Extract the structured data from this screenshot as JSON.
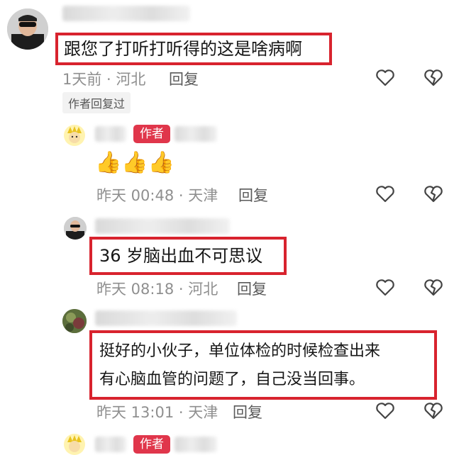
{
  "comments": [
    {
      "text": "跟您了打听打听得的这是啥病啊",
      "meta": "1天前 · 河北",
      "reply_label": "回复",
      "author_replied": "作者回复过"
    },
    {
      "badge": "作者",
      "emoji": "👍👍👍",
      "meta": "昨天 00:48 · 天津",
      "reply_label": "回复"
    },
    {
      "text": "36 岁脑出血不可思议",
      "meta": "昨天 08:18 · 河北",
      "reply_label": "回复"
    },
    {
      "line1": "挺好的小伙子，单位体检的时候检查出来",
      "line2": "有心脑血管的问题了，自己没当回事。",
      "meta": "昨天 13:01 · 天津",
      "reply_label": "回复"
    },
    {
      "badge": "作者"
    }
  ],
  "icons": {
    "like": "heart-outline-icon",
    "dislike": "broken-heart-icon"
  },
  "colors": {
    "highlight": "#d8232e",
    "badge": "#e0364b"
  }
}
